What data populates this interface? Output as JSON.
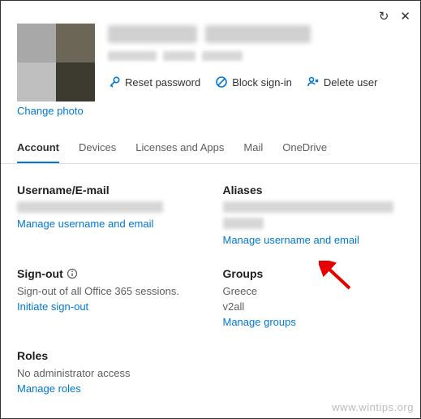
{
  "top": {
    "refresh_label": "Refresh",
    "close_label": "Close"
  },
  "header": {
    "change_photo": "Change photo",
    "actions": {
      "reset": "Reset password",
      "block": "Block sign-in",
      "delete": "Delete user"
    }
  },
  "tabs": {
    "account": "Account",
    "devices": "Devices",
    "licenses": "Licenses and Apps",
    "mail": "Mail",
    "onedrive": "OneDrive"
  },
  "sections": {
    "username": {
      "title": "Username/E-mail",
      "link": "Manage username and email"
    },
    "aliases": {
      "title": "Aliases",
      "link": "Manage username and email"
    },
    "signout": {
      "title": "Sign-out",
      "desc": "Sign-out of all Office 365 sessions.",
      "link": "Initiate sign-out"
    },
    "groups": {
      "title": "Groups",
      "items": [
        "Greece",
        "v2all"
      ],
      "link": "Manage groups"
    },
    "roles": {
      "title": "Roles",
      "desc": "No administrator access",
      "link": "Manage roles"
    }
  },
  "watermark": "www.wintips.org"
}
